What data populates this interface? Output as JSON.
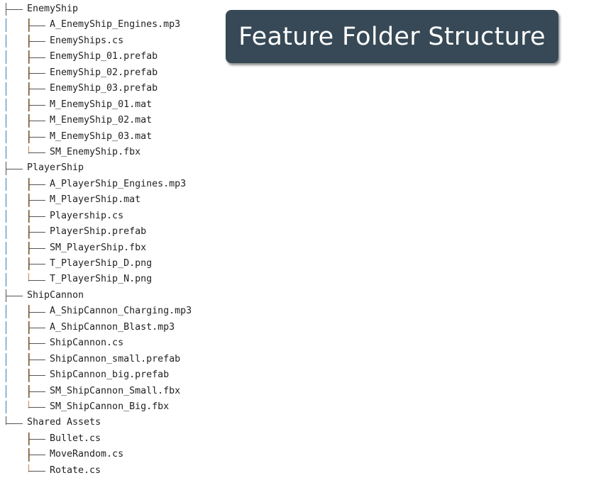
{
  "title": "Feature Folder Structure",
  "colors": {
    "title_bg": "#374956",
    "title_text": "#ffffff",
    "guide_line": "#3a7ab0",
    "branch_accent": "#d89a55"
  },
  "folders": [
    {
      "name": "EnemyShip",
      "files": [
        "A_EnemyShip_Engines.mp3",
        "EnemyShips.cs",
        "EnemyShip_01.prefab",
        "EnemyShip_02.prefab",
        "EnemyShip_03.prefab",
        "M_EnemyShip_01.mat",
        "M_EnemyShip_02.mat",
        "M_EnemyShip_03.mat",
        "SM_EnemyShip.fbx"
      ]
    },
    {
      "name": "PlayerShip",
      "files": [
        "A_PlayerShip_Engines.mp3",
        "M_PlayerShip.mat",
        "Playership.cs",
        "PlayerShip.prefab",
        "SM_PlayerShip.fbx",
        "T_PlayerShip_D.png",
        "T_PlayerShip_N.png"
      ]
    },
    {
      "name": "ShipCannon",
      "files": [
        "A_ShipCannon_Charging.mp3",
        "A_ShipCannon_Blast.mp3",
        "ShipCannon.cs",
        "ShipCannon_small.prefab",
        "ShipCannon_big.prefab",
        "SM_ShipCannon_Small.fbx",
        "SM_ShipCannon_Big.fbx"
      ]
    },
    {
      "name": "Shared Assets",
      "files": [
        "Bullet.cs",
        "MoveRandom.cs",
        "Rotate.cs"
      ]
    }
  ]
}
